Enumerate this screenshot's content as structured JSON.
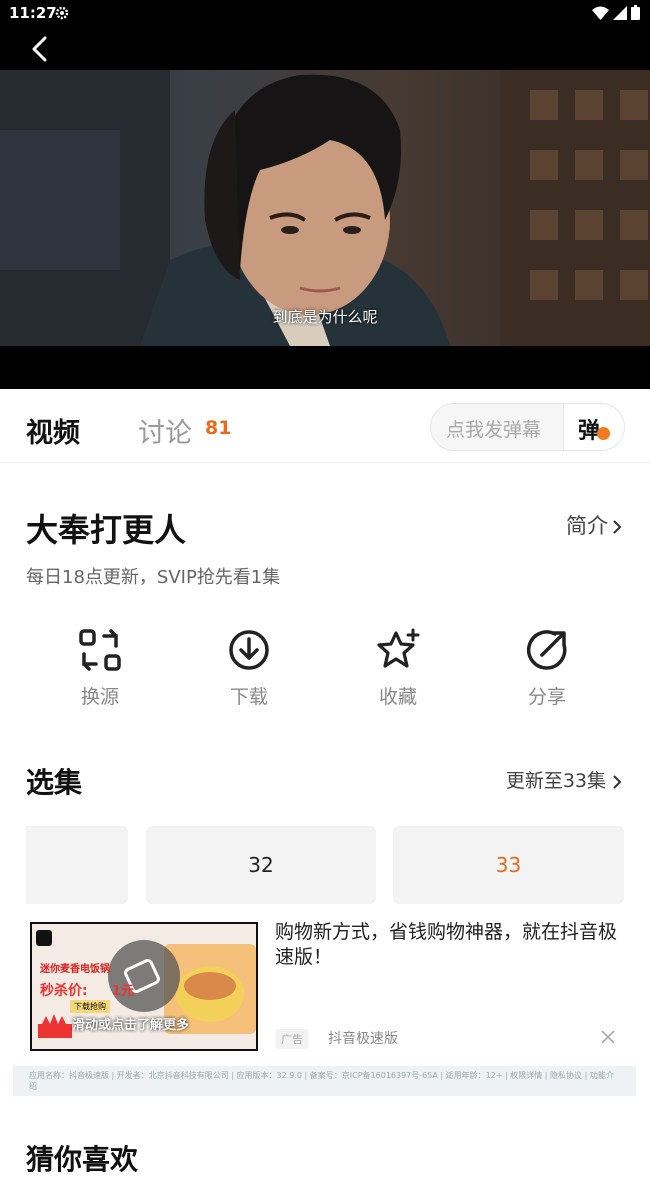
{
  "status_bar": {
    "time": "11:27"
  },
  "video": {
    "subtitle": "到底是为什么呢"
  },
  "tabs": {
    "video": "视频",
    "discussion": "讨论",
    "discussion_count": "81"
  },
  "danmu": {
    "placeholder": "点我发弹幕",
    "button": "弹"
  },
  "show": {
    "title": "大奉打更人",
    "intro_link": "简介",
    "update_info": "每日18点更新，SVIP抢先看1集"
  },
  "actions": [
    {
      "label": "换源",
      "icon": "switch-source-icon"
    },
    {
      "label": "下载",
      "icon": "download-icon"
    },
    {
      "label": "收藏",
      "icon": "favorite-icon"
    },
    {
      "label": "分享",
      "icon": "share-icon"
    }
  ],
  "episodes": {
    "section_title": "选集",
    "update_link": "更新至33集",
    "items": [
      {
        "label": ""
      },
      {
        "label": "32"
      },
      {
        "label": "33",
        "current": true
      }
    ],
    "accent_color": "#e86a1a"
  },
  "ad": {
    "text": "购物新方式，省钱购物神器，就在抖音极速版！",
    "tag": "广告",
    "source": "抖音极速版",
    "image_text": {
      "line1": "迷你麦香电饭锅",
      "price_label": "秒杀价:",
      "price": "1元",
      "cta": "下载抢购",
      "bottom": "滑动或点击了解更多"
    },
    "info": "应用名称：抖音极速版 | 开发者：北京抖音科技有限公司 | 应用版本：32.9.0 | 备案号：京ICP备16016397号-65A | 适用年龄：12+ | 权限详情 | 隐私协议 | 功能介绍"
  },
  "next_section": {
    "title": "猜你喜欢"
  }
}
